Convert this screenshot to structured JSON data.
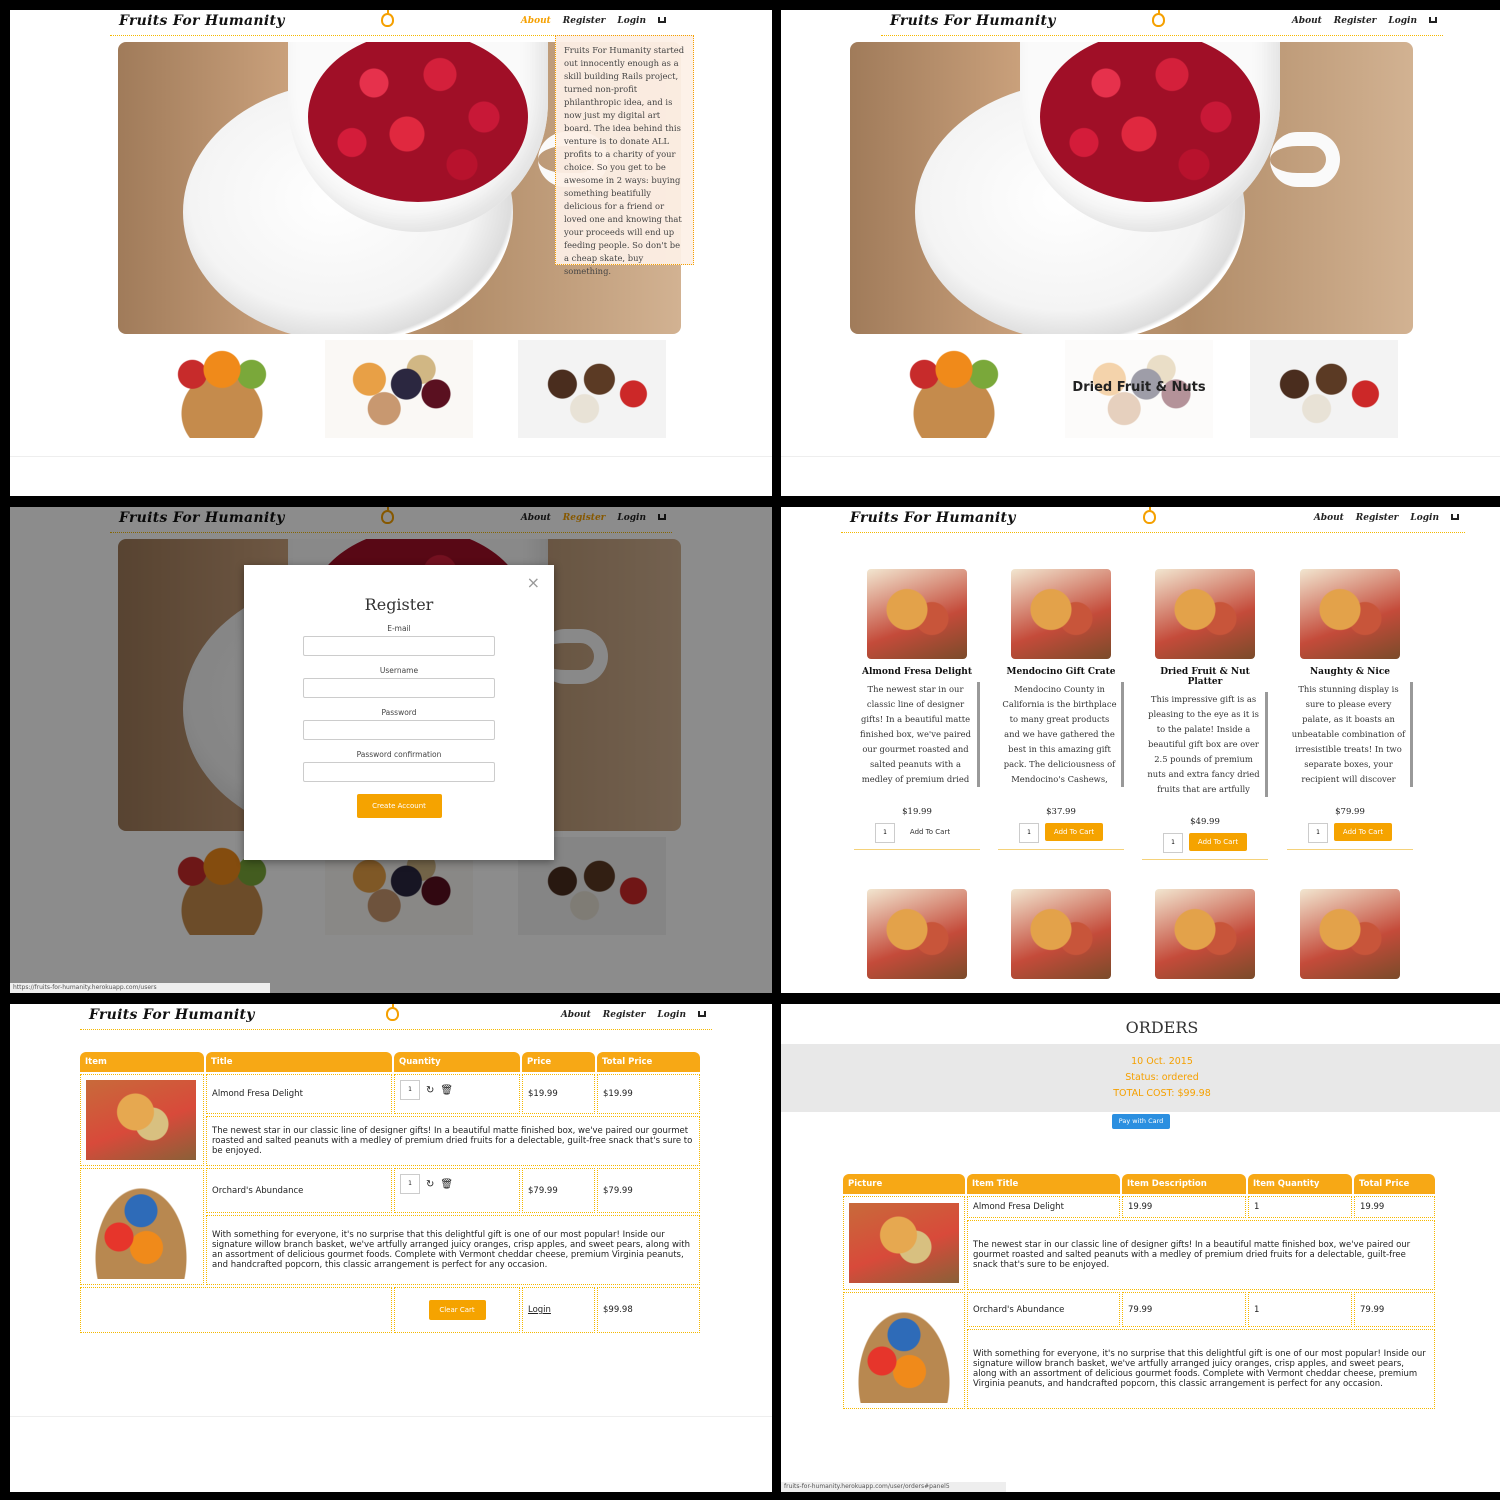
{
  "site": {
    "logo": "Fruits For Humanity",
    "nav": {
      "about": "About",
      "register": "Register",
      "login": "Login"
    }
  },
  "about_text": "Fruits For Humanity started out innocently enough as a skill building Rails project, turned non-profit philanthropic idea, and is now just my digital art board. The idea behind this venture is to donate ALL profits to a charity of your choice. So you get to be awesome in 2 ways: buying something beatifully delicious for a friend or loved one and knowing that your proceeds will end up feeding people. So don't be a cheap skate, buy something.",
  "category_hover_label": "Dried Fruit & Nuts",
  "register_modal": {
    "title": "Register",
    "close": "×",
    "email_label": "E-mail",
    "username_label": "Username",
    "password_label": "Password",
    "password_confirmation_label": "Password confirmation",
    "submit": "Create Account"
  },
  "status_bar": {
    "users": "https://fruits-for-humanity.herokuapp.com/users",
    "orders": "fruits-for-humanity.herokuapp.com/user/orders#panel5"
  },
  "products": [
    {
      "title": "Almond Fresa Delight",
      "desc": "The newest star in our classic line of designer gifts! In a beautiful matte finished box, we've paired our gourmet roasted and salted peanuts with a medley of premium dried fruits for a delectable,",
      "price": "$19.99",
      "qty": "1",
      "add": "Add To Cart"
    },
    {
      "title": "Mendocino Gift Crate",
      "desc": "Mendocino County in California is the birthplace to many great products and we have gathered the best in this amazing gift pack. The deliciousness of Mendocino's Cashews, Almonds, Cherry",
      "price": "$37.99",
      "qty": "1",
      "add": "Add To Cart"
    },
    {
      "title": "Dried Fruit & Nut Platter",
      "desc": "This impressive gift is as pleasing to the eye as it is to the palate! Inside a beautiful gift box are over 2.5 pounds of premium nuts and extra fancy dried fruits that are artfully arranged in an elegant rose",
      "price": "$49.99",
      "qty": "1",
      "add": "Add To Cart"
    },
    {
      "title": "Naughty & Nice",
      "desc": "This stunning display is sure to please every palate, as it boasts an unbeatable combination of irresistible treats! In two separate boxes, your recipient will discover beautiful arrangements of",
      "price": "$79.99",
      "qty": "1",
      "add": "Add To Cart"
    }
  ],
  "cart": {
    "headers": [
      "Item",
      "Title",
      "Quantity",
      "Price",
      "Total Price"
    ],
    "rows": [
      {
        "title": "Almond Fresa Delight",
        "qty": "1",
        "price": "$19.99",
        "total": "$19.99",
        "desc": "The newest star in our classic line of designer gifts! In a beautiful matte finished box, we've paired our gourmet roasted and salted peanuts with a medley of premium dried fruits for a delectable, guilt-free snack that's sure to be enjoyed."
      },
      {
        "title": "Orchard's Abundance",
        "qty": "1",
        "price": "$79.99",
        "total": "$79.99",
        "desc": "With something for everyone, it's no surprise that this delightful gift is one of our most popular! Inside our signature willow branch basket, we've artfully arranged juicy oranges, crisp apples, and sweet pears, along with an assortment of delicious gourmet foods. Complete with Vermont cheddar cheese, premium Virginia peanuts, and handcrafted popcorn, this classic arrangement is perfect for any occasion."
      }
    ],
    "clear": "Clear Cart",
    "login": "Login",
    "grand_total": "$99.98"
  },
  "orders": {
    "title": "ORDERS",
    "date": "10 Oct. 2015",
    "status": "Status: ordered",
    "total": "TOTAL COST: $99.98",
    "pay": "Pay with Card",
    "headers": [
      "Picture",
      "Item Title",
      "Item Description",
      "Item Quantity",
      "Total Price"
    ],
    "rows": [
      {
        "title": "Almond Fresa Delight",
        "price": "19.99",
        "qty": "1",
        "total": "19.99",
        "desc": "The newest star in our classic line of designer gifts! In a beautiful matte finished box, we've paired our gourmet roasted and salted peanuts with a medley of premium dried fruits for a delectable, guilt-free snack that's sure to be enjoyed."
      },
      {
        "title": "Orchard's Abundance",
        "price": "79.99",
        "qty": "1",
        "total": "79.99",
        "desc": "With something for everyone, it's no surprise that this delightful gift is one of our most popular! Inside our signature willow branch basket, we've artfully arranged juicy oranges, crisp apples, and sweet pears, along with an assortment of delicious gourmet foods. Complete with Vermont cheddar cheese, premium Virginia peanuts, and handcrafted popcorn, this classic arrangement is perfect for any occasion."
      }
    ]
  }
}
